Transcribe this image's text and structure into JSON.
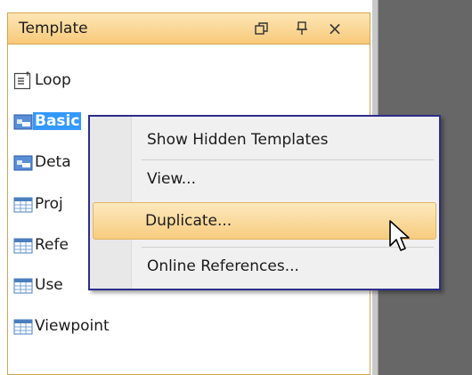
{
  "panel": {
    "title": "Template",
    "controls": [
      {
        "name": "restore-icon"
      },
      {
        "name": "pin-icon"
      },
      {
        "name": "close-icon",
        "glyph": "×"
      }
    ]
  },
  "tree": {
    "items": [
      {
        "label": "Loop",
        "icon": "loop-template-icon"
      },
      {
        "label": "Basic",
        "icon": "basic-template-icon",
        "selected": true
      },
      {
        "label": "Deta",
        "icon": "basic-template-icon"
      },
      {
        "label": "Proj",
        "icon": "table-template-icon"
      },
      {
        "label": "Refe",
        "icon": "table-template-icon"
      },
      {
        "label": "Use",
        "icon": "table-template-icon"
      },
      {
        "label": "Viewpoint",
        "icon": "table-template-icon"
      }
    ]
  },
  "context_menu": {
    "items": [
      {
        "label": "Show Hidden Templates"
      },
      {
        "label": "View..."
      },
      {
        "label": "Duplicate...",
        "highlighted": true
      },
      {
        "label": "Online References..."
      }
    ]
  },
  "colors": {
    "header_gradient_top": "#fde6b5",
    "header_gradient_bottom": "#f7c97a",
    "selection": "#3399ff",
    "menu_border": "#2d2d8a",
    "highlight": "#f7cc7f"
  }
}
